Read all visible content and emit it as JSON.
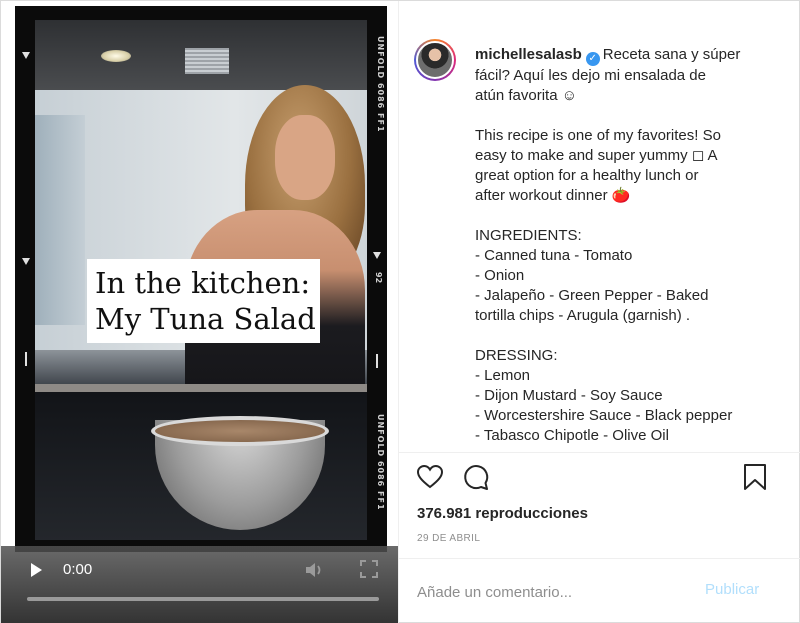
{
  "video": {
    "overlay_caption": [
      "In the kitchen:",
      "My Tuna Salad"
    ],
    "film_edge_text": "UNFOLD 6086 FF1",
    "film_edge_number": "92",
    "time": "0:00",
    "progress": 0
  },
  "post": {
    "username": "michellesalasb",
    "verified": true,
    "caption_lines": [
      "Receta sana y súper",
      "fácil? Aquí les dejo mi ensalada de",
      "atún favorita ☺",
      "",
      "This recipe is one of my favorites! So",
      "easy to make and super yummy ◻ A",
      "great option for a healthy lunch or",
      "after workout dinner 🍅",
      "",
      "INGREDIENTS:",
      "- Canned tuna - Tomato",
      "- Onion",
      "- Jalapeño - Green Pepper - Baked",
      "tortilla chips - Arugula (garnish) .",
      "",
      "DRESSING:",
      "- Lemon",
      "- Dijon Mustard - Soy Sauce",
      "- Worcestershire Sauce - Black pepper",
      "- Tabasco Chipotle - Olive Oil"
    ],
    "views": "376.981 reproducciones",
    "date": "29 DE ABRIL"
  },
  "comment": {
    "placeholder": "Añade un comentario...",
    "publish_label": "Publicar"
  },
  "icons": {
    "like": "heart-icon",
    "comment": "comment-icon",
    "save": "bookmark-icon",
    "play": "play-icon",
    "volume": "volume-icon",
    "fullscreen": "fullscreen-icon",
    "verified": "verified-badge-icon"
  },
  "colors": {
    "verified": "#3897f0",
    "publish_disabled": "#b2dffc",
    "secondary_text": "#8e8e8e"
  }
}
